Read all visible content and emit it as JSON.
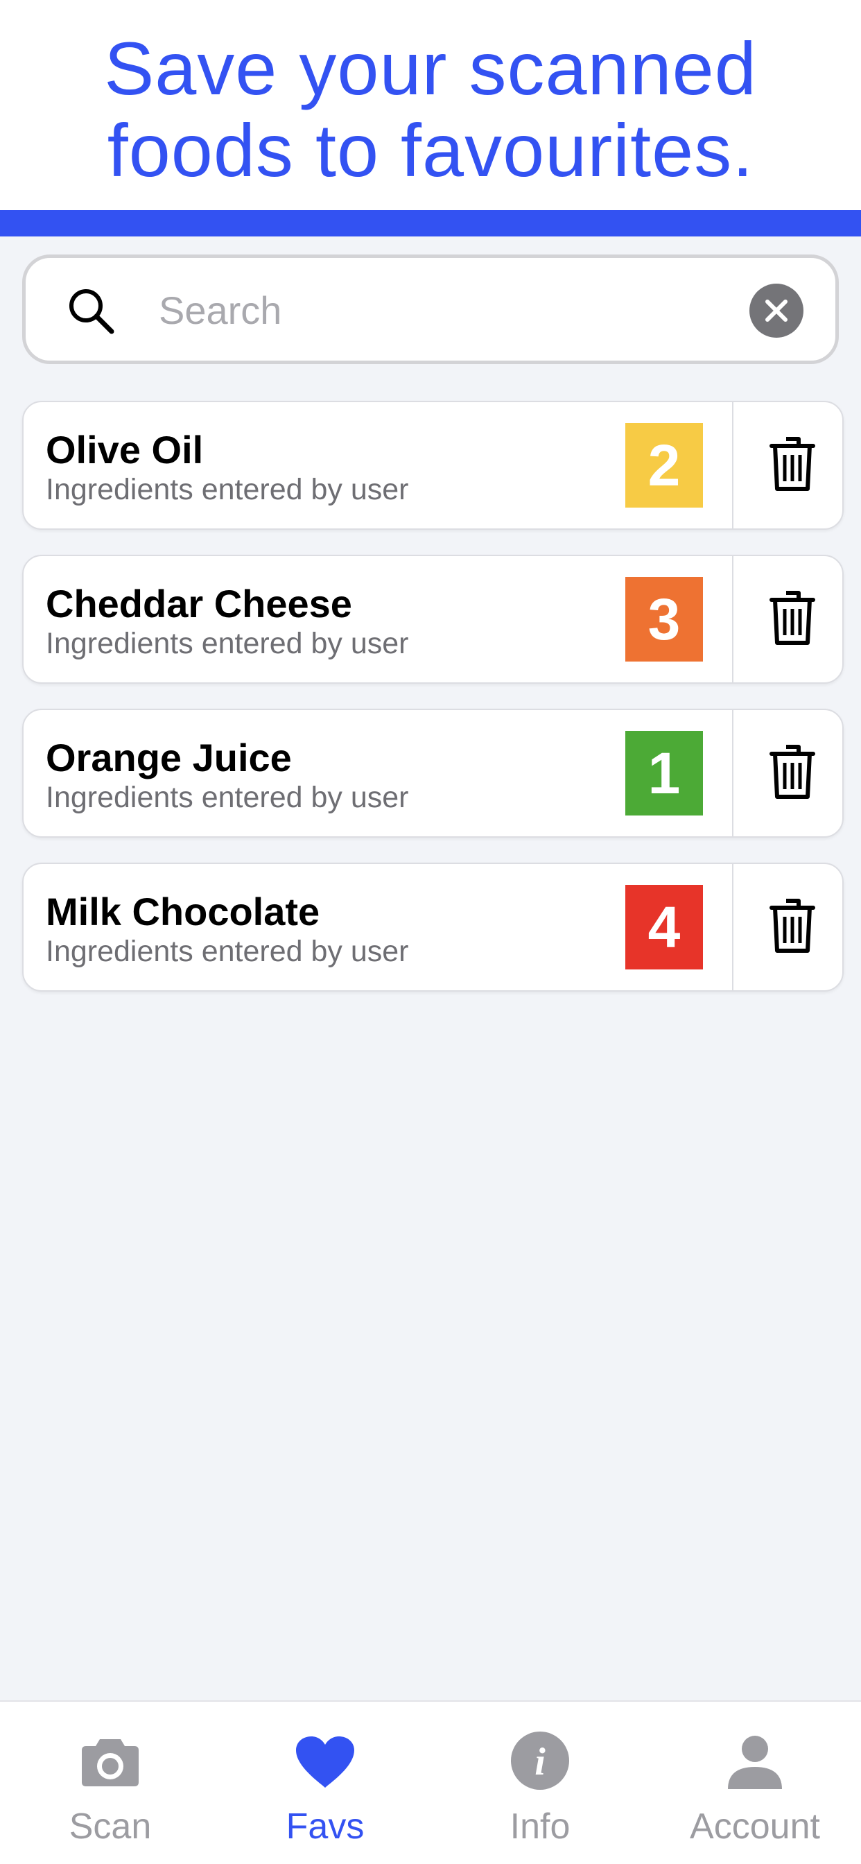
{
  "headline": {
    "line1": "Save your scanned",
    "line2": "foods to favourites."
  },
  "search": {
    "placeholder": "Search",
    "value": ""
  },
  "favourites": [
    {
      "name": "Olive Oil",
      "subtitle": "Ingredients entered by user",
      "score": "2",
      "score_color": "#f7cb45"
    },
    {
      "name": "Cheddar Cheese",
      "subtitle": "Ingredients entered by user",
      "score": "3",
      "score_color": "#ee7232"
    },
    {
      "name": "Orange Juice",
      "subtitle": "Ingredients entered by user",
      "score": "1",
      "score_color": "#4caa36"
    },
    {
      "name": "Milk Chocolate",
      "subtitle": "Ingredients entered by user",
      "score": "4",
      "score_color": "#e73429"
    }
  ],
  "tabs": [
    {
      "label": "Scan",
      "icon": "camera-icon",
      "active": false
    },
    {
      "label": "Favs",
      "icon": "heart-icon",
      "active": true
    },
    {
      "label": "Info",
      "icon": "info-icon",
      "active": false
    },
    {
      "label": "Account",
      "icon": "person-icon",
      "active": false
    }
  ],
  "colors": {
    "accent": "#3352f2",
    "background": "#f2f4f8",
    "inactive_tab": "#9c9ca1"
  }
}
